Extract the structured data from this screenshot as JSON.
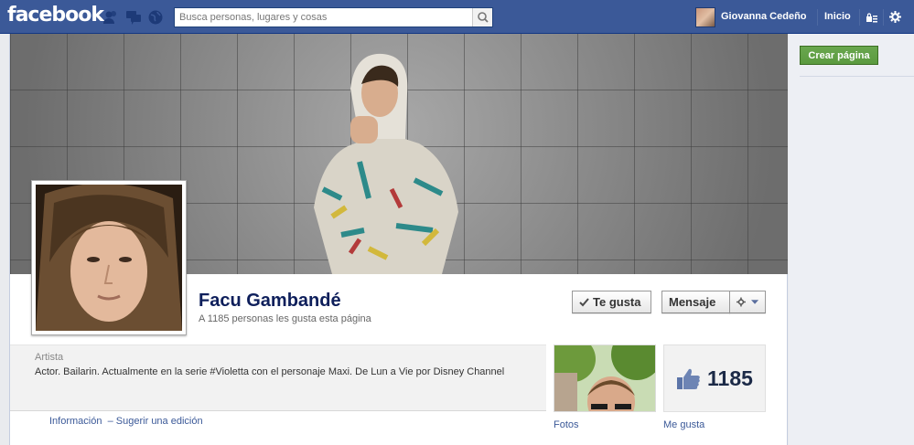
{
  "header": {
    "logo": "facebook",
    "search_placeholder": "Busca personas, lugares y cosas",
    "user_name": "Giovanna Cedeño",
    "home_label": "Inicio"
  },
  "page": {
    "name": "Facu Gambandé",
    "likes_text": "A 1185 personas les gusta esta página",
    "like_button": "Te gusta",
    "message_button": "Mensaje",
    "category": "Artista",
    "description": "Actor. Bailarin. Actualmente en la serie #Violetta con el personaje Maxi. De Lun a Vie por Disney Channel",
    "info_link": "Información",
    "separator": "–",
    "suggest_link": "Sugerir una edición",
    "photos_label": "Fotos",
    "like_count": "1185",
    "likes_label": "Me gusta"
  },
  "sidebar": {
    "create_page": "Crear página"
  },
  "colors": {
    "brand": "#3b5998",
    "create_button": "#5b9a3f"
  }
}
